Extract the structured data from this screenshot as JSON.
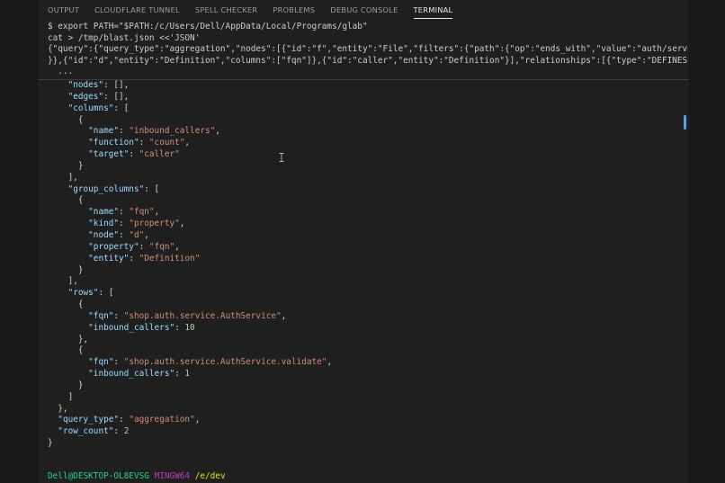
{
  "tabs": [
    {
      "label": "OUTPUT"
    },
    {
      "label": "CLOUDFLARE TUNNEL"
    },
    {
      "label": "SPELL CHECKER"
    },
    {
      "label": "PROBLEMS"
    },
    {
      "label": "DEBUG CONSOLE"
    },
    {
      "label": "TERMINAL"
    }
  ],
  "active_tab": "TERMINAL",
  "command": {
    "line1": "$ export PATH=\"$PATH:/c/Users/Dell/AppData/Local/Programs/glab\"",
    "line2": "cat > /tmp/blast.json <<'JSON'",
    "line3": "{\"query\":{\"query_type\":\"aggregation\",\"nodes\":[{\"id\":\"f\",\"entity\":\"File\",\"filters\":{\"path\":{\"op\":\"ends_with\",\"value\":\"auth/service.py\"",
    "line4": "}},{\"id\":\"d\",\"entity\":\"Definition\",\"columns\":[\"fqn\"]},{\"id\":\"caller\",\"entity\":\"Definition\"}],\"relationships\":[{\"type\":\"DEFINES\",\"from\"",
    "line5": "  ..."
  },
  "output": {
    "nodes_key": "\"nodes\"",
    "edges_key": "\"edges\"",
    "columns_key": "\"columns\"",
    "col_name_key": "\"name\"",
    "col_name_val": "\"inbound_callers\"",
    "col_function_key": "\"function\"",
    "col_function_val": "\"count\"",
    "col_target_key": "\"target\"",
    "col_target_val": "\"caller\"",
    "group_columns_key": "\"group_columns\"",
    "gc_name_key": "\"name\"",
    "gc_name_val": "\"fqn\"",
    "gc_kind_key": "\"kind\"",
    "gc_kind_val": "\"property\"",
    "gc_node_key": "\"node\"",
    "gc_node_val": "\"d\"",
    "gc_property_key": "\"property\"",
    "gc_property_val": "\"fqn\"",
    "gc_entity_key": "\"entity\"",
    "gc_entity_val": "\"Definition\"",
    "rows_key": "\"rows\"",
    "row1_fqn_key": "\"fqn\"",
    "row1_fqn_val": "\"shop.auth.service.AuthService\"",
    "row1_callers_key": "\"inbound_callers\"",
    "row1_callers_val": "10",
    "row2_fqn_key": "\"fqn\"",
    "row2_fqn_val": "\"shop.auth.service.AuthService.validate\"",
    "row2_callers_key": "\"inbound_callers\"",
    "row2_callers_val": "1",
    "query_type_key": "\"query_type\"",
    "query_type_val": "\"aggregation\"",
    "row_count_key": "\"row_count\"",
    "row_count_val": "2"
  },
  "prompt": {
    "user": "Dell@DESKTOP-OL8EVSG",
    "system": "MINGW64",
    "dir": "/e/dev"
  },
  "colors": {
    "background": "#1f1f1f",
    "json_key": "#9cdcfe",
    "json_string": "#ce9178",
    "json_number": "#b5cea8",
    "prompt_user": "#23d18b",
    "prompt_system": "#bc3fbc",
    "prompt_dir": "#e5e510"
  }
}
